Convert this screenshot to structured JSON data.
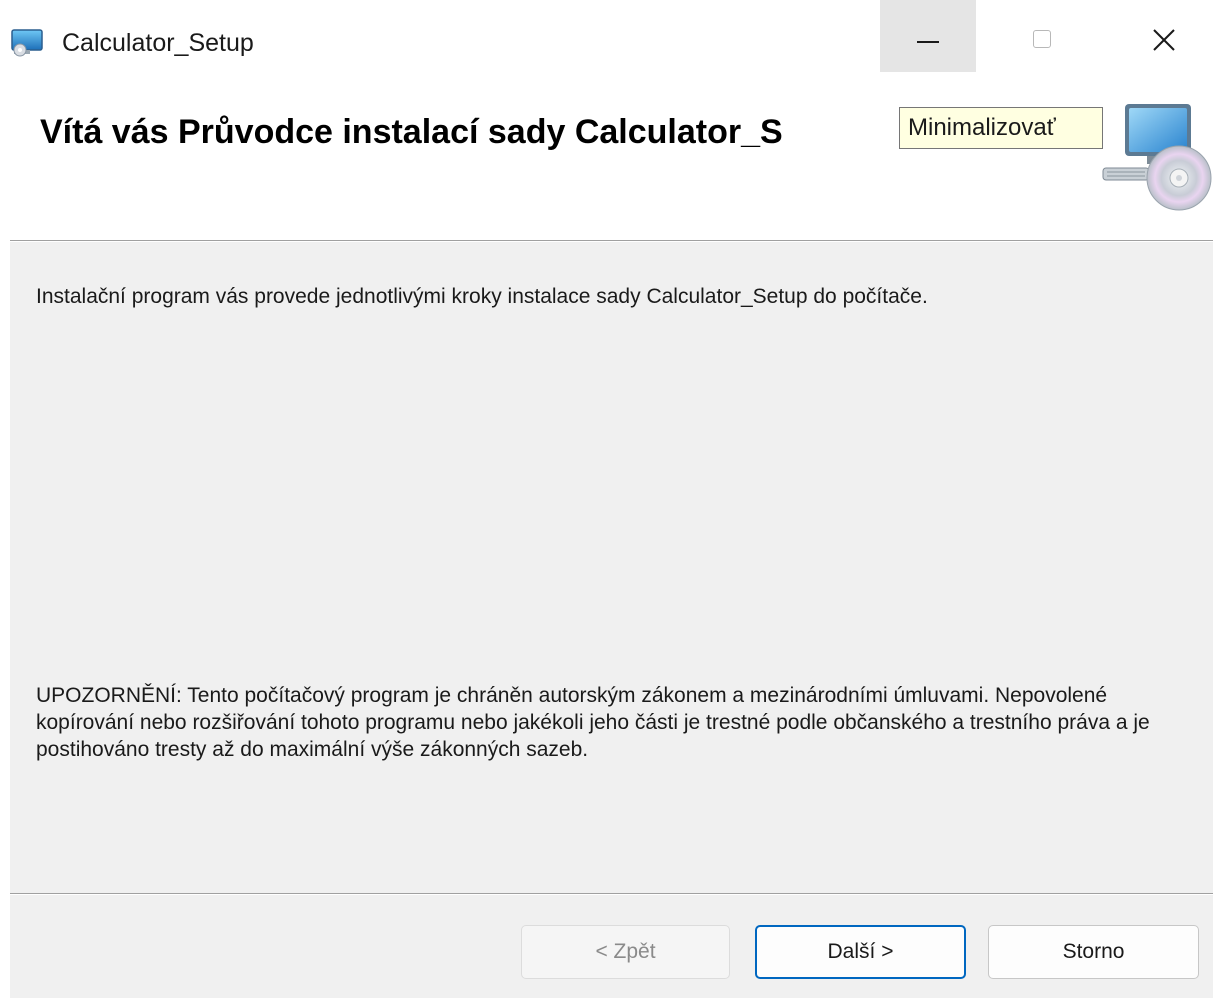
{
  "window": {
    "title": "Calculator_Setup",
    "controls": {
      "minimize_icon": "minimize-icon",
      "maximize_icon": "maximize-icon",
      "close_icon": "close-icon"
    }
  },
  "header": {
    "title": "Vítá vás Průvodce instalací sady Calculator_S",
    "tooltip": "Minimalizovať",
    "icon": "setup-computer-disc-icon"
  },
  "body": {
    "intro": "Instalační program vás provede jednotlivými kroky instalace sady Calculator_Setup do počítače.",
    "notice": "UPOZORNĚNÍ: Tento počítačový program je chráněn autorským zákonem a mezinárodními úmluvami. Nepovolené kopírování nebo rozšiřování tohoto programu nebo jakékoli jeho části je trestné podle občanského a trestního práva a je postihováno tresty až do maximální výše zákonných sazeb."
  },
  "buttons": {
    "back": "< Zpět",
    "next": "Další >",
    "cancel": "Storno"
  },
  "colors": {
    "dialog_background": "#f0f0f0",
    "tooltip_background": "#ffffe1",
    "accent_border": "#0067c0"
  }
}
